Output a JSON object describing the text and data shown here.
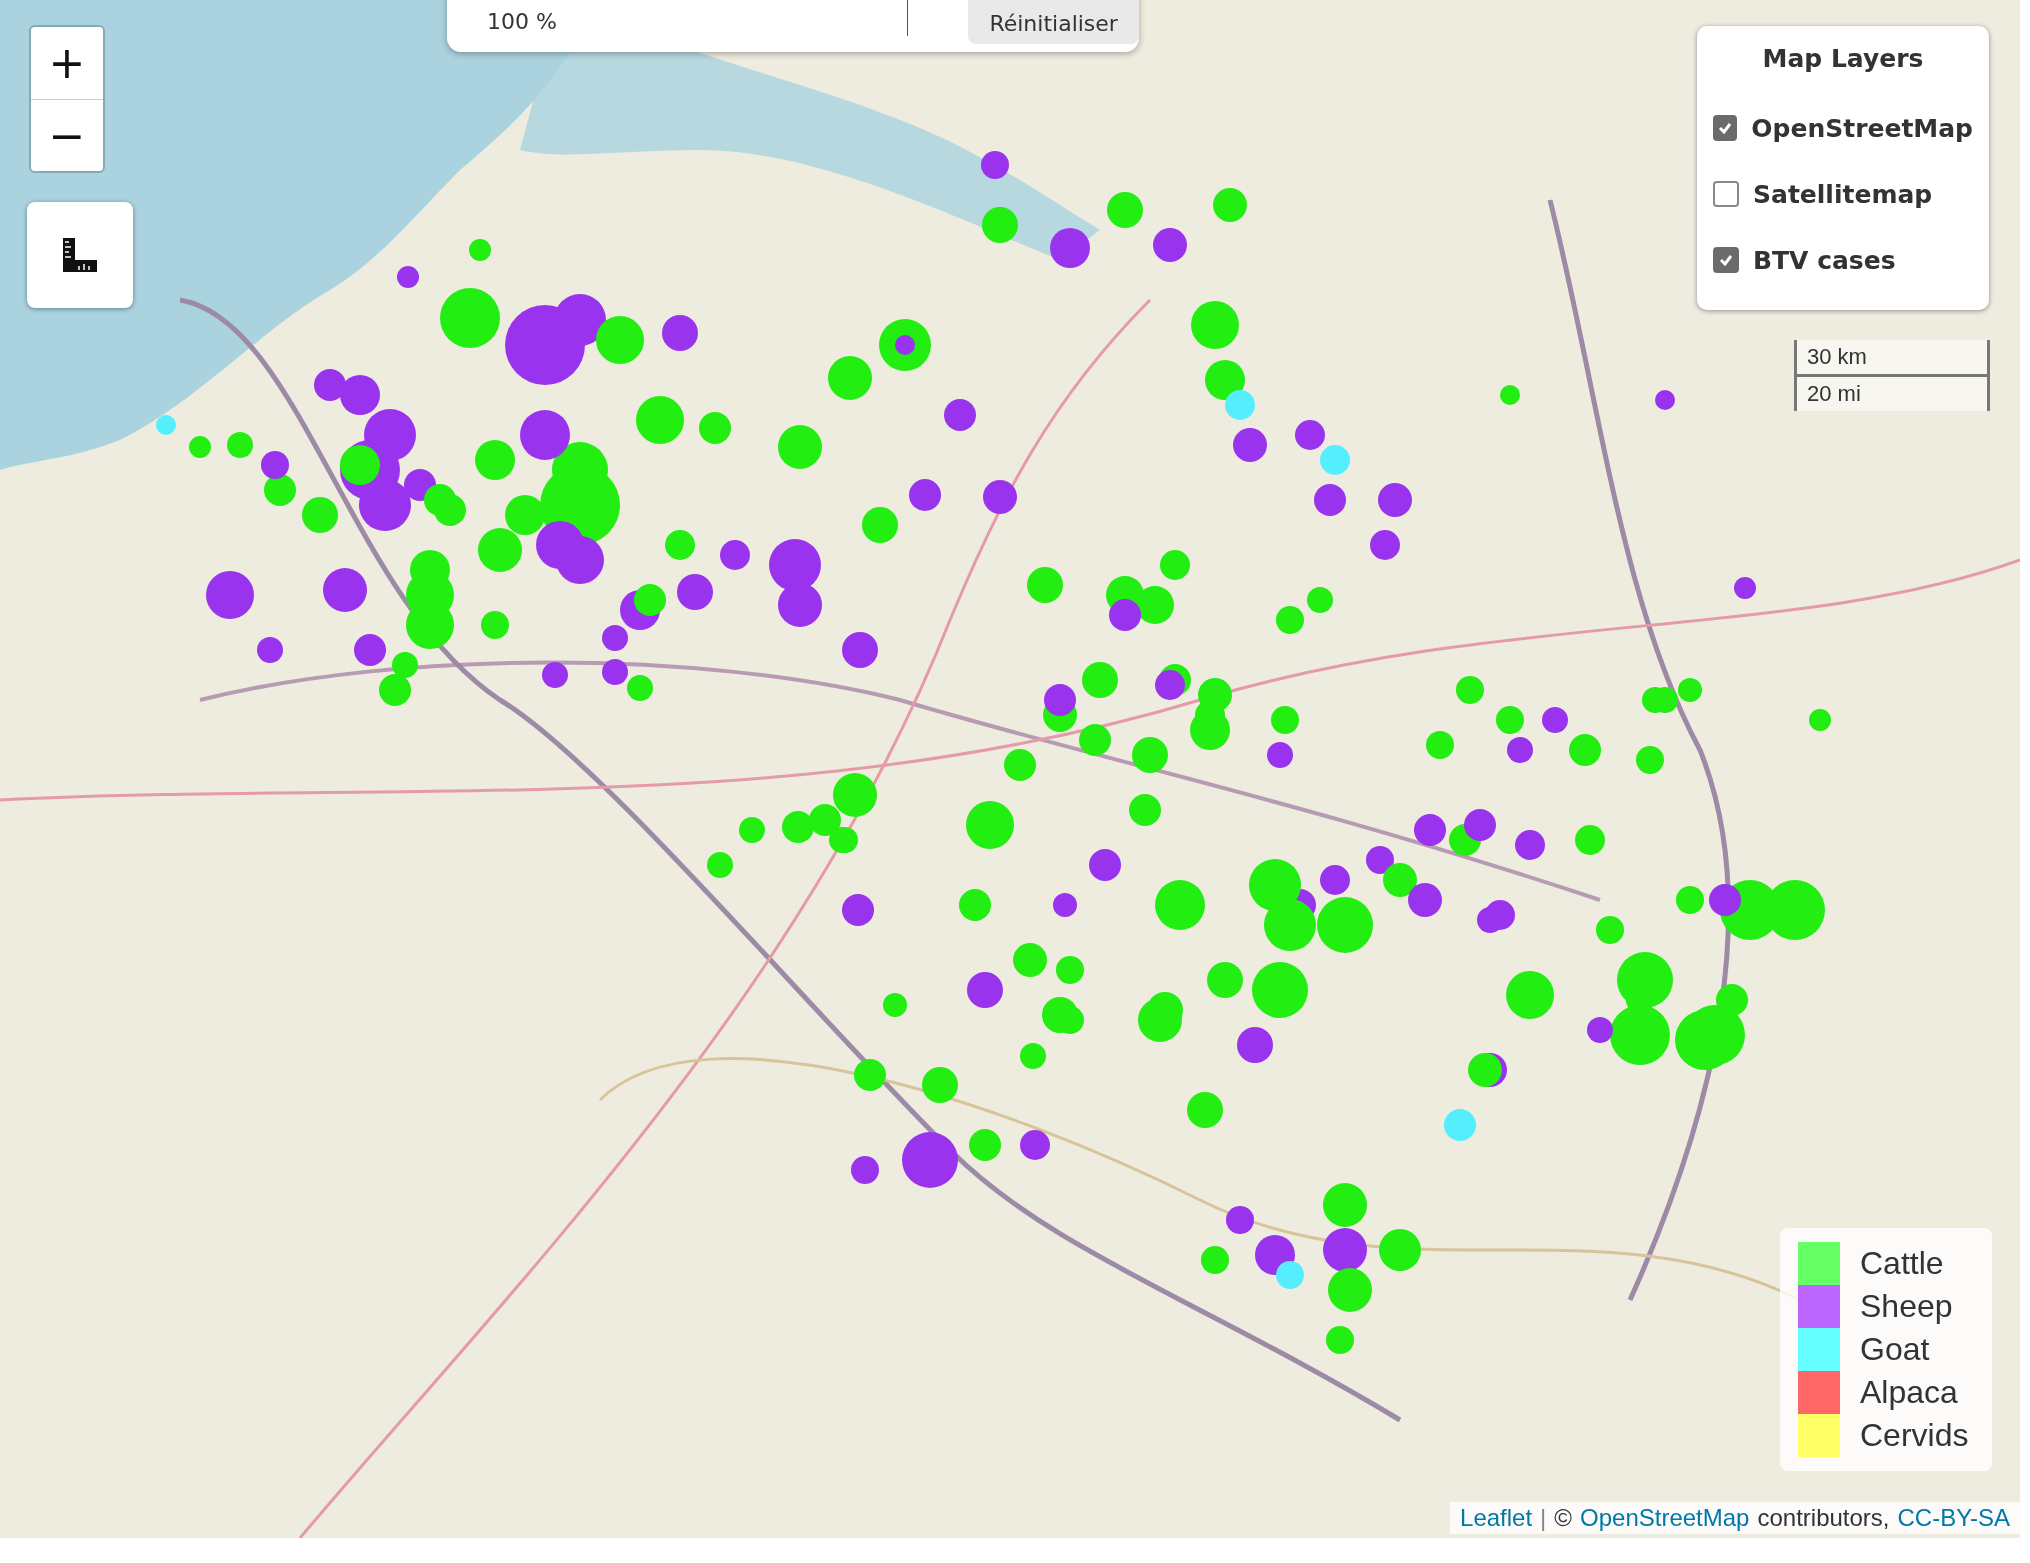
{
  "top_panel": {
    "zoom_value": "100 %",
    "reset_button": "Réinitialiser"
  },
  "zoom_controls": {
    "zoom_in": "+",
    "zoom_out": "−"
  },
  "layers_control": {
    "title": "Map Layers",
    "items": [
      {
        "label": "OpenStreetMap",
        "checked": true
      },
      {
        "label": "Satellitemap",
        "checked": false
      },
      {
        "label": "BTV cases",
        "checked": true
      }
    ]
  },
  "scale_bar": {
    "metric": "30 km",
    "imperial": "20 mi"
  },
  "legend": {
    "items": [
      {
        "label": "Cattle",
        "color": "#66ff66"
      },
      {
        "label": "Sheep",
        "color": "#bb66ff"
      },
      {
        "label": "Goat",
        "color": "#66ffff"
      },
      {
        "label": "Alpaca",
        "color": "#ff6666"
      },
      {
        "label": "Cervids",
        "color": "#ffff66"
      }
    ]
  },
  "attribution": {
    "leaflet": "Leaflet",
    "separator": "|",
    "copyright": "©",
    "osm": "OpenStreetMap",
    "contributors": "contributors,",
    "license": "CC-BY-SA"
  }
}
